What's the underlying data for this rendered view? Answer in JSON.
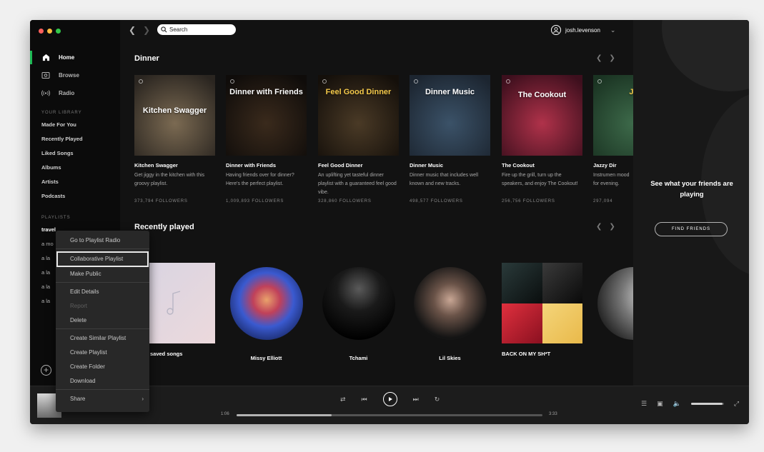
{
  "sidebar": {
    "nav": [
      {
        "label": "Home",
        "icon": "home-icon",
        "active": true
      },
      {
        "label": "Browse",
        "icon": "browse-icon"
      },
      {
        "label": "Radio",
        "icon": "radio-icon"
      }
    ],
    "library_heading": "YOUR LIBRARY",
    "library": [
      "Made For You",
      "Recently Played",
      "Liked Songs",
      "Albums",
      "Artists",
      "Podcasts"
    ],
    "playlists_heading": "PLAYLISTS",
    "playlists": [
      "travel",
      "a mo",
      "a la",
      "a la",
      "a la",
      "a la"
    ]
  },
  "topbar": {
    "search_placeholder": "Search",
    "username": "josh.levenson"
  },
  "dinner": {
    "title": "Dinner",
    "cards": [
      {
        "cover_text": "Kitchen Swagger",
        "title": "Kitchen Swagger",
        "desc": "Get jiggy in the kitchen with this groovy playlist.",
        "followers": "373,794 FOLLOWERS",
        "color1": "#7b6a52",
        "color2": "#2a2520",
        "label_color": "#ffffff"
      },
      {
        "cover_text": "Dinner with Friends",
        "title": "Dinner with Friends",
        "desc": "Having friends over for dinner? Here's the perfect playlist.",
        "followers": "1,009,893 FOLLOWERS",
        "color1": "#3a2a1c",
        "color2": "#0f0c0a",
        "label_color": "#ffffff"
      },
      {
        "cover_text": "Feel Good Dinner",
        "title": "Feel Good Dinner",
        "desc": "An uplifting yet tasteful dinner playlist with a guaranteed feel good vibe.",
        "followers": "328,860 FOLLOWERS",
        "color1": "#4a3a26",
        "color2": "#140f0a",
        "label_color": "#f4c94a"
      },
      {
        "cover_text": "Dinner Music",
        "title": "Dinner Music",
        "desc": "Dinner music that includes well known and new tracks.",
        "followers": "498,577 FOLLOWERS",
        "color1": "#3b5268",
        "color2": "#1c2530",
        "label_color": "#ffffff"
      },
      {
        "cover_text": "The Cookout",
        "title": "The Cookout",
        "desc": "Fire up the grill, turn up the speakers, and enjoy The Cookout!",
        "followers": "256,756 FOLLOWERS",
        "color1": "#b0324a",
        "color2": "#3d0f1d",
        "label_color": "#ffffff"
      },
      {
        "cover_text": "Ja",
        "title": "Jazzy Dir",
        "desc": "Instrumen mood for evening.",
        "followers": "297,094",
        "color1": "#3d6a4a",
        "color2": "#1a3322",
        "label_color": "#f4c94a"
      }
    ]
  },
  "recent": {
    "title": "Recently played",
    "items": [
      {
        "name": "saved songs",
        "kind": "square"
      },
      {
        "name": "Missy Elliott",
        "kind": "circle"
      },
      {
        "name": "Tchami",
        "kind": "circle"
      },
      {
        "name": "Lil Skies",
        "kind": "circle"
      },
      {
        "name": "BACK ON MY SH*T",
        "kind": "square"
      }
    ]
  },
  "friends": {
    "message": "See what your friends are playing",
    "button": "FIND FRIENDS"
  },
  "player": {
    "elapsed": "1:06",
    "duration": "3:33",
    "progress": 0.31,
    "volume": 0.95
  },
  "context_menu": {
    "items": [
      {
        "label": "Go to Playlist Radio"
      },
      {
        "sep": true
      },
      {
        "label": "Collaborative Playlist",
        "highlight": true
      },
      {
        "label": "Make Public"
      },
      {
        "sep": true
      },
      {
        "label": "Edit Details"
      },
      {
        "label": "Report",
        "disabled": true
      },
      {
        "label": "Delete"
      },
      {
        "sep": true
      },
      {
        "label": "Create Similar Playlist"
      },
      {
        "label": "Create Playlist"
      },
      {
        "label": "Create Folder"
      },
      {
        "label": "Download"
      },
      {
        "sep": true
      },
      {
        "label": "Share",
        "submenu": true
      }
    ]
  },
  "colors": {
    "accent": "#1db954",
    "background": "#121212",
    "sidebar": "#0b0b0b"
  }
}
